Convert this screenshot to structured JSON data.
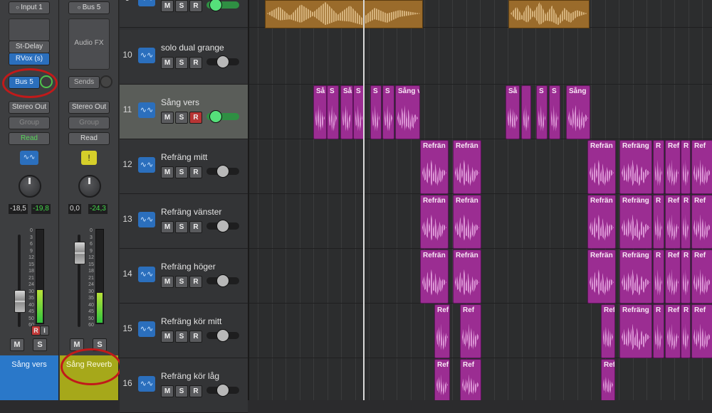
{
  "mixer": {
    "strips": [
      {
        "input": "Input 1",
        "plugins": [
          "St-Delay",
          "RVox (s)"
        ],
        "send": "Bus 5",
        "output": "Stereo Out",
        "group": "Group",
        "automation": "Read",
        "values": [
          "-18,5",
          "-19,8"
        ],
        "buttons": [
          "M",
          "S"
        ],
        "rec_buttons": [
          "R",
          "I"
        ],
        "name": "Sång vers",
        "name_color": "#2a78c9"
      },
      {
        "input": "Bus 5",
        "plugins": [
          "Audio FX"
        ],
        "send": "Sends",
        "output": "Stereo Out",
        "group": "Group",
        "automation": "Read",
        "values": [
          "0,0",
          "-24,3"
        ],
        "buttons": [
          "M",
          "S"
        ],
        "name": "Sång Reverb",
        "name_color": "#a6a81a"
      }
    ],
    "meter_scale": [
      "0",
      "3",
      "6",
      "9",
      "12",
      "15",
      "18",
      "21",
      "24",
      "30",
      "35",
      "40",
      "45",
      "50",
      "60"
    ]
  },
  "tracks": [
    {
      "num": "9",
      "name": "",
      "buttons": [
        "M",
        "S",
        "R"
      ]
    },
    {
      "num": "10",
      "name": "solo dual grange",
      "buttons": [
        "M",
        "S",
        "R"
      ]
    },
    {
      "num": "11",
      "name": "Sång vers",
      "buttons": [
        "M",
        "S",
        "R"
      ],
      "selected": true
    },
    {
      "num": "12",
      "name": "Refräng mitt",
      "buttons": [
        "M",
        "S",
        "R"
      ]
    },
    {
      "num": "13",
      "name": "Refräng vänster",
      "buttons": [
        "M",
        "S",
        "R"
      ]
    },
    {
      "num": "14",
      "name": "Refräng höger",
      "buttons": [
        "M",
        "S",
        "R"
      ]
    },
    {
      "num": "15",
      "name": "Refräng kör mitt",
      "buttons": [
        "M",
        "S",
        "R"
      ]
    },
    {
      "num": "16",
      "name": "Refräng kör låg",
      "buttons": [
        "M",
        "S",
        "R"
      ]
    }
  ],
  "region_labels": {
    "sang_short": "Så",
    "s": "S",
    "sang_v": "Sång v",
    "sang": "Sång",
    "refran": "Refrän",
    "refrain_full": "Refräng",
    "ref": "Ref",
    "r": "R"
  },
  "colors": {
    "region_purple": "#9b2d92",
    "region_gold": "#9a6b2b",
    "selection_ring": "#c11a1a",
    "track_icon_blue": "#2b6fbd"
  }
}
